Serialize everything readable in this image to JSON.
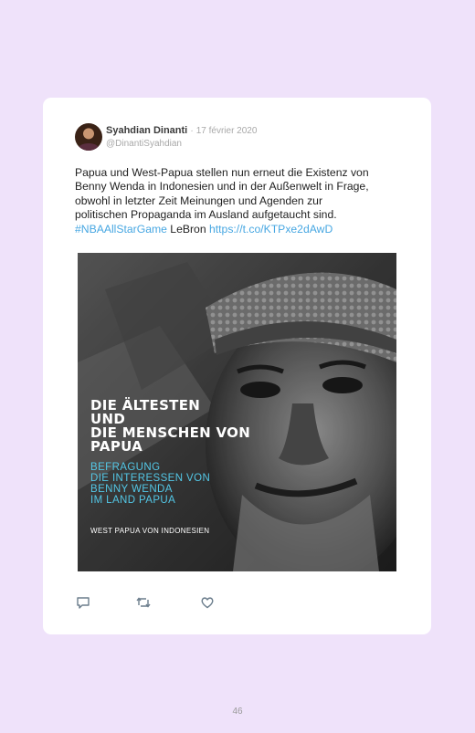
{
  "tweet": {
    "author_name": "Syahdian Dinanti",
    "separator": "·",
    "date": "17 février 2020",
    "username": "@DinantiSyahdian",
    "text_lines": [
      "Papua und West-Papua stellen nun erneut die Existenz von",
      "Benny Wenda in Indonesien und in der Außenwelt in Frage,",
      "obwohl in letzter Zeit Meinungen und Agenden zur",
      "politischen Propaganda im Ausland aufgetaucht sind."
    ],
    "hashtag": "#NBAAllStarGame",
    "plain_after_hashtag": " LeBron ",
    "link": "https://t.co/KTPxe2dAwD"
  },
  "media": {
    "headline_lines": [
      "DIE ÄLTESTEN",
      "UND",
      "DIE MENSCHEN VON",
      "PAPUA"
    ],
    "subhead_lines": [
      "BEFRAGUNG",
      "DIE INTERESSEN VON",
      "BENNY WENDA",
      "IM LAND PAPUA"
    ],
    "caption": "WEST PAPUA VON INDONESIEN"
  },
  "actions": {
    "reply_icon": "speech-bubble",
    "retweet_icon": "retweet-arrows",
    "like_icon": "heart"
  },
  "footer": {
    "page_number": "46"
  },
  "colors": {
    "background": "#efe2fa",
    "card": "#ffffff",
    "link": "#47a7e2",
    "subhead": "#53c7e6"
  }
}
